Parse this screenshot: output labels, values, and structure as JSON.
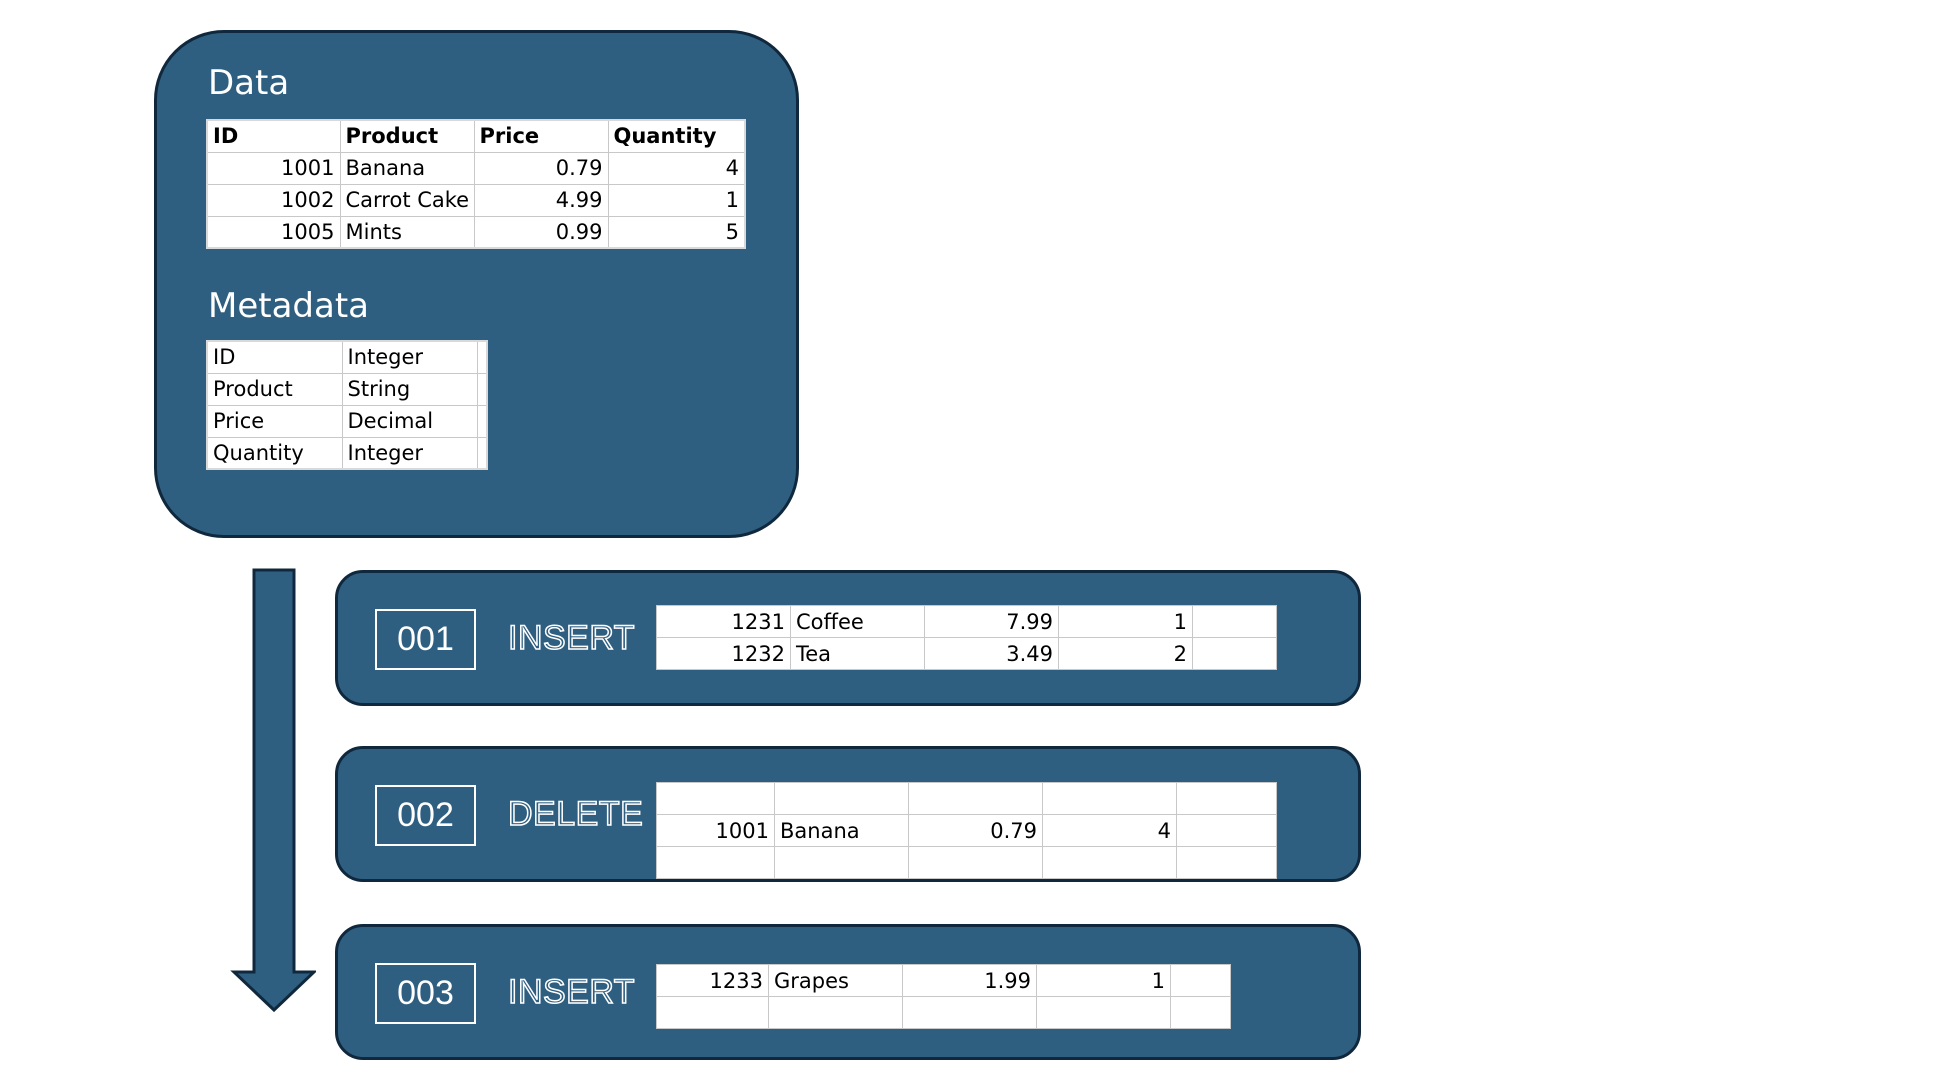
{
  "data_panel": {
    "heading": "Data",
    "columns": [
      "ID",
      "Product",
      "Price",
      "Quantity"
    ],
    "rows": [
      [
        "1001",
        "Banana",
        "0.79",
        "4"
      ],
      [
        "1002",
        "Carrot Cake",
        "4.99",
        "1"
      ],
      [
        "1005",
        "Mints",
        "0.99",
        "5"
      ]
    ]
  },
  "metadata_panel": {
    "heading": "Metadata",
    "rows": [
      [
        "ID",
        "Integer"
      ],
      [
        "Product",
        "String"
      ],
      [
        "Price",
        "Decimal"
      ],
      [
        "Quantity",
        "Integer"
      ]
    ]
  },
  "log_entries": [
    {
      "seq": "001",
      "op": "INSERT",
      "rows": [
        [
          "1231",
          "Coffee",
          "7.99",
          "1"
        ],
        [
          "1232",
          "Tea",
          "3.49",
          "2"
        ]
      ]
    },
    {
      "seq": "002",
      "op": "DELETE",
      "rows": [
        [
          "1001",
          "Banana",
          "0.79",
          "4"
        ]
      ]
    },
    {
      "seq": "003",
      "op": "INSERT",
      "rows": [
        [
          "1233",
          "Grapes",
          "1.99",
          "1"
        ]
      ]
    }
  ],
  "colors": {
    "panel_fill": "#2f5f80",
    "panel_border": "#10283d",
    "text_light": "#ffffff"
  }
}
